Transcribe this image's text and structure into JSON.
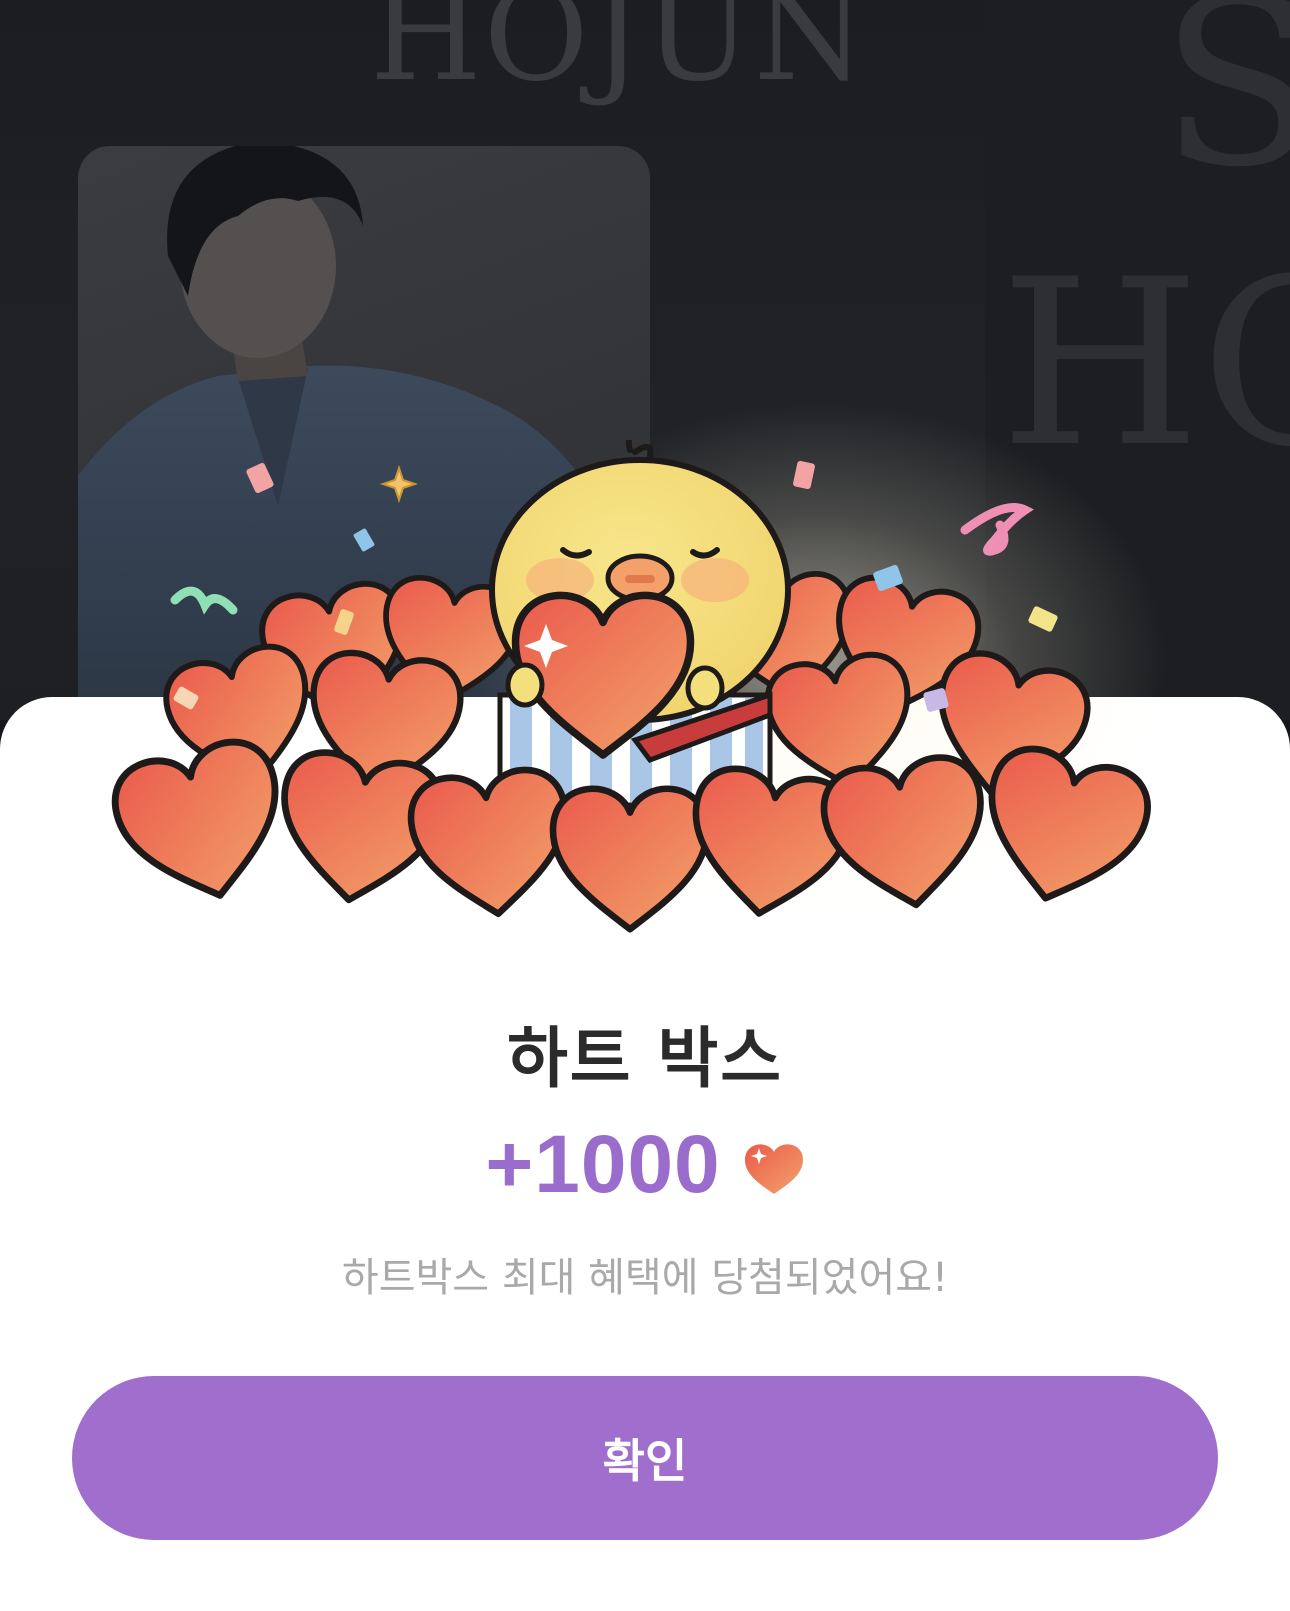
{
  "background": {
    "wordmark": "HOJUN",
    "side_letters": "HO",
    "side_letter_top": "S"
  },
  "dialog": {
    "title": "하트 박스",
    "reward_amount": "+1000",
    "reward_icon": "heart-icon",
    "message": "하트박스 최대 혜택에 당첨되었어요!",
    "confirm_label": "확인"
  },
  "colors": {
    "accent": "#a06ecd",
    "reward_text": "#9a6ccb",
    "title_text": "#2b2b2b",
    "message_text": "#a9a9a9",
    "heart_start": "#ea5a4c",
    "heart_end": "#f3a36a",
    "chick_body": "#f3df7c"
  }
}
